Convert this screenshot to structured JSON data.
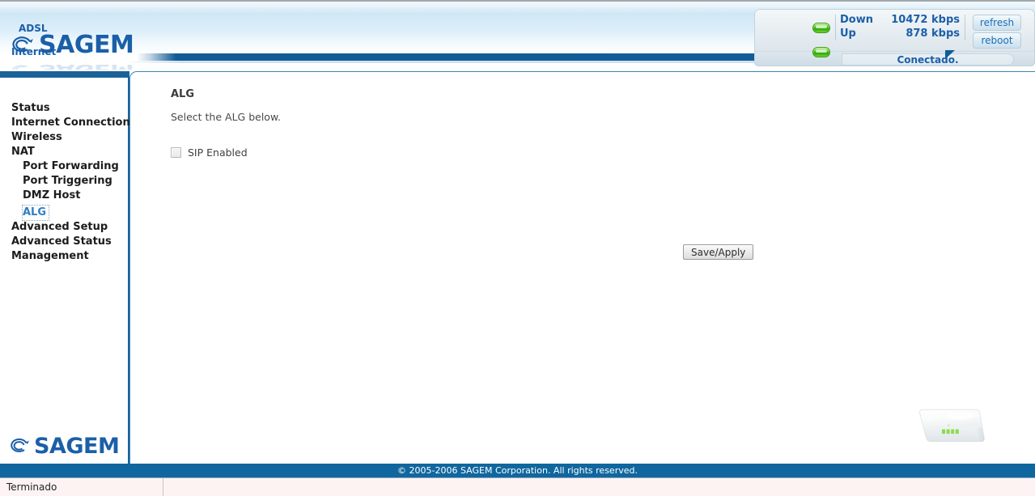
{
  "brand": {
    "name": "SAGEM",
    "logo_icon": "sagem-swirl-icon"
  },
  "status_panel": {
    "adsl_label": "ADSL",
    "adsl_led": "green-led-icon",
    "internet_label": "Internet",
    "internet_led": "green-led-icon",
    "down_label": "Down",
    "down_value": "10472 kbps",
    "up_label": "Up",
    "up_value": "878 kbps",
    "connection_status": "Conectado.",
    "refresh_label": "refresh",
    "reboot_label": "reboot"
  },
  "sidebar": {
    "items": [
      {
        "label": "Status",
        "sub": false,
        "active": false
      },
      {
        "label": "Internet Connection",
        "sub": false,
        "active": false
      },
      {
        "label": "Wireless",
        "sub": false,
        "active": false
      },
      {
        "label": "NAT",
        "sub": false,
        "active": false
      },
      {
        "label": "Port Forwarding",
        "sub": true,
        "active": false
      },
      {
        "label": "Port Triggering",
        "sub": true,
        "active": false
      },
      {
        "label": "DMZ Host",
        "sub": true,
        "active": false
      },
      {
        "label": "ALG",
        "sub": true,
        "active": true
      },
      {
        "label": "Advanced Setup",
        "sub": false,
        "active": false
      },
      {
        "label": "Advanced Status",
        "sub": false,
        "active": false
      },
      {
        "label": "Management",
        "sub": false,
        "active": false
      }
    ]
  },
  "main": {
    "title": "ALG",
    "description": "Select the ALG below.",
    "sip_checkbox_label": "SIP Enabled",
    "sip_checked": false,
    "save_label": "Save/Apply"
  },
  "footer": {
    "copyright": "© 2005-2006 SAGEM Corporation. All rights reserved."
  },
  "browser": {
    "status_text": "Terminado"
  },
  "colors": {
    "brand_blue": "#1b5fa8",
    "bar_blue": "#0e5d99",
    "sidebar_border": "#1b6299",
    "panel_border": "#3a87b5",
    "led_green": "#4fc81d",
    "active_link": "#2f7fc4"
  }
}
